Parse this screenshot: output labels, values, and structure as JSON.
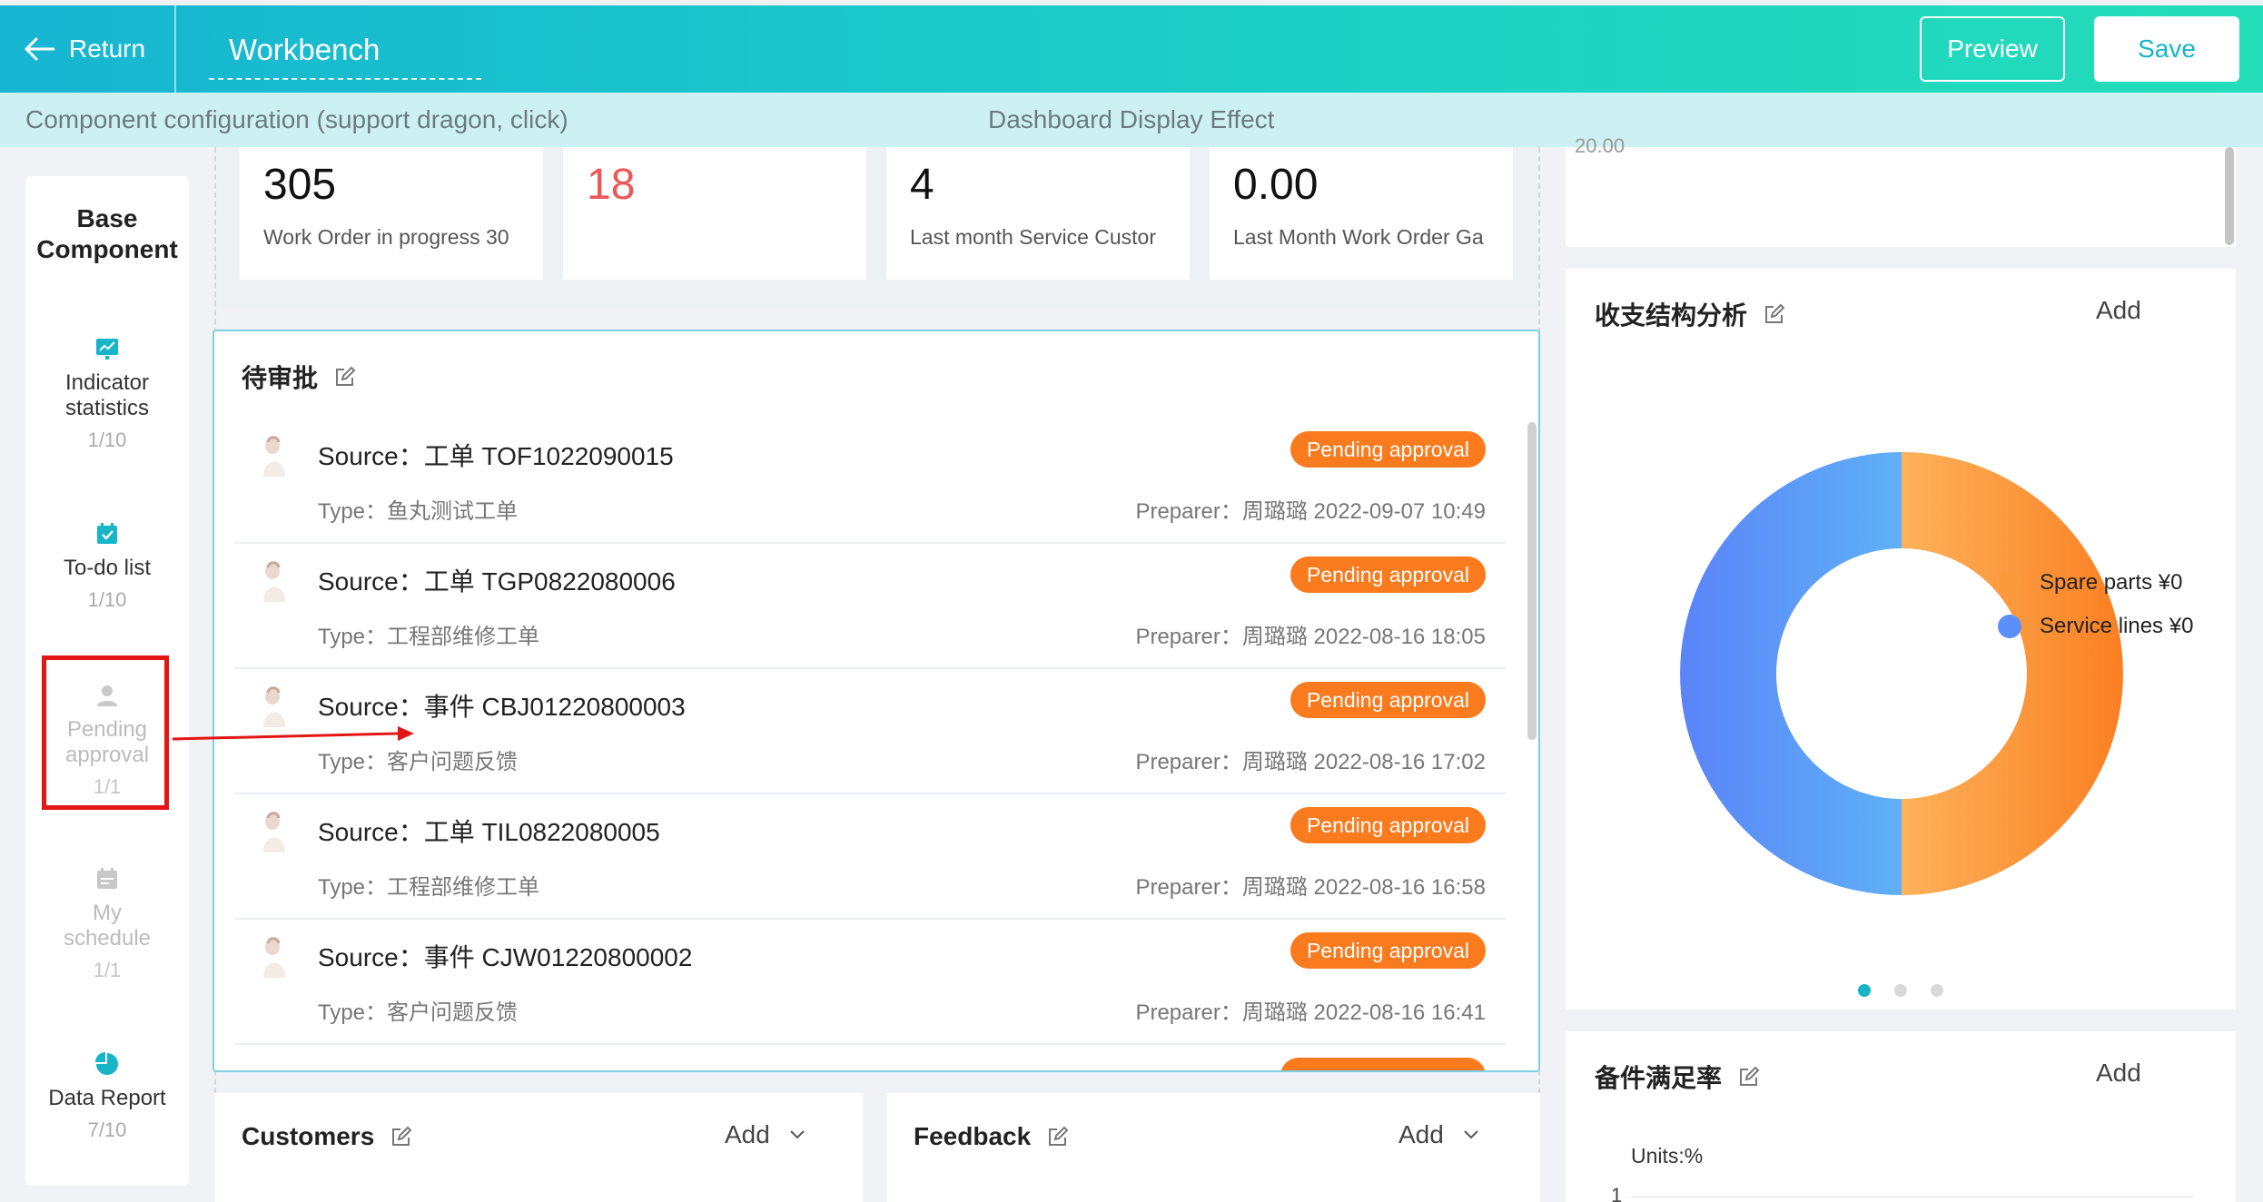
{
  "header": {
    "return_label": "Return",
    "title": "Workbench",
    "preview_label": "Preview",
    "save_label": "Save"
  },
  "subheader": {
    "left_text": "Component configuration (support dragon, click)",
    "center_text": "Dashboard Display Effect"
  },
  "left_panel": {
    "title_line1": "Base",
    "title_line2": "Component",
    "items": [
      {
        "label_line1": "Indicator",
        "label_line2": "statistics",
        "count": "1/10",
        "icon": "chart-icon"
      },
      {
        "label_line1": "To-do list",
        "label_line2": "",
        "count": "1/10",
        "icon": "calendar-check-icon"
      },
      {
        "label_line1": "Pending",
        "label_line2": "approval",
        "count": "1/1",
        "icon": "user-icon"
      },
      {
        "label_line1": "My",
        "label_line2": "schedule",
        "count": "1/1",
        "icon": "calendar-icon"
      },
      {
        "label_line1": "Data Report",
        "label_line2": "",
        "count": "7/10",
        "icon": "pie-icon"
      }
    ]
  },
  "stats": [
    {
      "value": "305",
      "label": "Work Order in progress  30"
    },
    {
      "value": "18",
      "label": ""
    },
    {
      "value": "4",
      "label": "Last month Service Custor"
    },
    {
      "value": "0.00",
      "label": "Last Month Work Order Ga"
    }
  ],
  "pending_approval": {
    "title": "待审批",
    "items": [
      {
        "source": "Source：工单 TOF1022090015",
        "type": "Type：鱼丸测试工单",
        "preparer": "Preparer：周璐璐    2022-09-07 10:49",
        "status": "Pending approval"
      },
      {
        "source": "Source：工单 TGP0822080006",
        "type": "Type：工程部维修工单",
        "preparer": "Preparer：周璐璐    2022-08-16 18:05",
        "status": "Pending approval"
      },
      {
        "source": "Source：事件 CBJ01220800003",
        "type": "Type：客户问题反馈",
        "preparer": "Preparer：周璐璐    2022-08-16 17:02",
        "status": "Pending approval"
      },
      {
        "source": "Source：工单 TIL0822080005",
        "type": "Type：工程部维修工单",
        "preparer": "Preparer：周璐璐    2022-08-16 16:58",
        "status": "Pending approval"
      },
      {
        "source": "Source：事件 CJW01220800002",
        "type": "Type：客户问题反馈",
        "preparer": "Preparer：周璐璐    2022-08-16 16:41",
        "status": "Pending approval"
      }
    ]
  },
  "bottom_cards": {
    "customers_title": "Customers",
    "feedback_title": "Feedback",
    "add_label": "Add"
  },
  "right_panel": {
    "top_cut_value": "20.00",
    "income_title": "收支结构分析",
    "add_label": "Add",
    "legend": [
      {
        "name": "Spare parts ¥0",
        "color": "#fb8c2a"
      },
      {
        "name": "Service lines ¥0",
        "color": "#5b8ff9"
      }
    ],
    "spare_title": "备件满足率",
    "units": "Units:%",
    "axis_first": "1"
  },
  "chart_data": {
    "type": "pie",
    "title": "收支结构分析",
    "labels": [
      "Spare parts ¥0",
      "Service lines ¥0"
    ],
    "values": [
      50,
      50
    ],
    "colors": [
      "#fb8c2a",
      "#5b8ff9"
    ],
    "donut": true,
    "legend_position": "bottom-right"
  }
}
